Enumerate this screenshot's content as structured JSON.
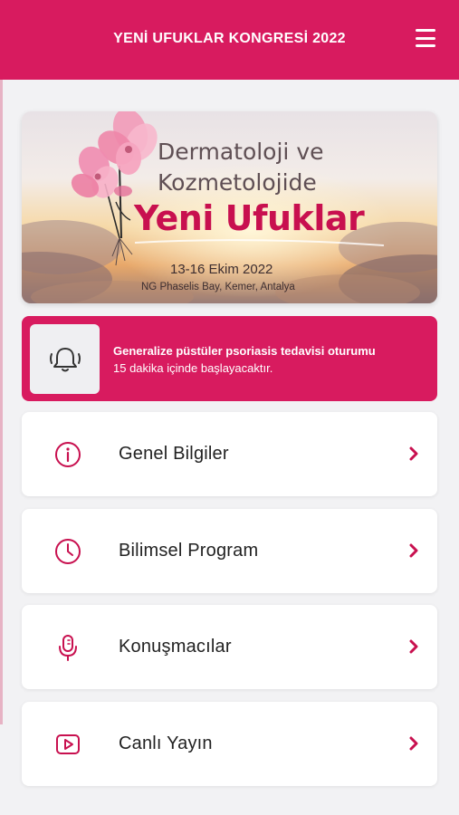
{
  "colors": {
    "brand": "#d81b5f",
    "background": "#f2f2f4",
    "icon": "#c8104f"
  },
  "header": {
    "title": "YENİ UFUKLAR KONGRESİ 2022",
    "menu_icon": "hamburger-menu-icon"
  },
  "banner": {
    "line1": "Dermatoloji ve",
    "line2": "Kozmetolojide",
    "headline": "Yeni Ufuklar",
    "date": "13-16 Ekim 2022",
    "venue": "NG Phaselis Bay, Kemer, Antalya"
  },
  "notification": {
    "icon": "ringing-bell-icon",
    "title": "Generalize püstüler psoriasis tedavisi oturumu",
    "subtitle": "15 dakika içinde başlayacaktır."
  },
  "menu": {
    "items": [
      {
        "label": "Genel Bilgiler",
        "icon": "info-icon"
      },
      {
        "label": "Bilimsel Program",
        "icon": "clock-icon"
      },
      {
        "label": "Konuşmacılar",
        "icon": "microphone-icon"
      },
      {
        "label": "Canlı Yayın",
        "icon": "play-video-icon"
      }
    ]
  }
}
